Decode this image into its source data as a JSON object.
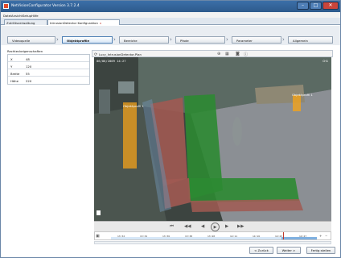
{
  "window": {
    "title": "NetVisionConfigurator Version 3.7.2.4",
    "minimize": "–",
    "maximize": "□",
    "close": "✕"
  },
  "menu": [
    "Datei",
    "Ansicht",
    "Setup",
    "Hilfe"
  ],
  "doc_tabs": [
    {
      "label": "Zutrittsverwaltung",
      "active": false
    },
    {
      "label": "IntrusionDetector Konfiguration",
      "active": true,
      "close": "x"
    }
  ],
  "wizard_steps": [
    "Videoquelle",
    "Objektprofile",
    "Bereiche",
    "Pfade",
    "Parameter",
    "Allgemein"
  ],
  "active_step": "Objektprofile",
  "properties": {
    "title": "Rechteckeigenschaften",
    "rows": [
      {
        "key": "X",
        "value": "48"
      },
      {
        "key": "Y",
        "value": "120"
      },
      {
        "key": "Breite",
        "value": "55"
      },
      {
        "key": "Höhe",
        "value": "220"
      }
    ]
  },
  "video": {
    "header_title": "Lucy_IntrusionDetector.Plan",
    "osd_datetime": "06/06/2009 14:27",
    "osd_camera": "CH1",
    "label_left": "Objektprofil 1",
    "label_right": "Objektprofil 1"
  },
  "controls": {
    "rewind": "⏮",
    "back": "◀◀",
    "step_back": "◀",
    "play": "▶",
    "step_fwd": "▶",
    "fwd": "▶▶"
  },
  "timeline": {
    "ticks": [
      "13:32",
      "13:34",
      "13:36",
      "13:38",
      "13:40",
      "14:11",
      "14:16",
      "14:23",
      "14:27"
    ]
  },
  "footer": {
    "back": "< Zurück",
    "next": "Weiter >",
    "finish": "Fertig stellen"
  },
  "colors": {
    "accent": "#2d5a8c",
    "overlay_orange": "#f3a21a",
    "overlay_green": "#3cc83c",
    "overlay_red": "#b0332e"
  }
}
